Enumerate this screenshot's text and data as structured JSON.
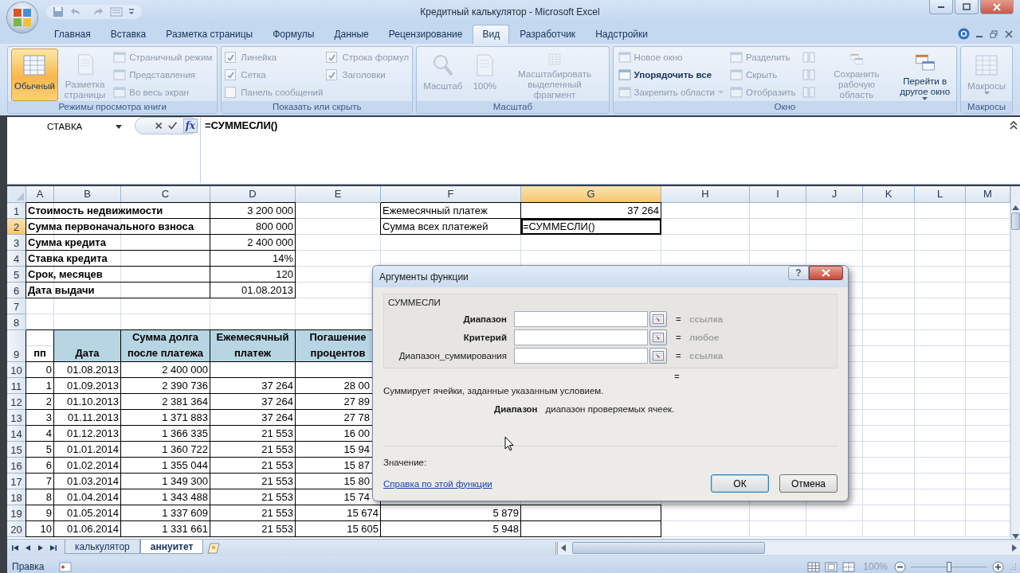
{
  "window": {
    "title": "Кредитный калькулятор - Microsoft Excel"
  },
  "tabs": [
    {
      "label": "Главная",
      "selected": false
    },
    {
      "label": "Вставка",
      "selected": false
    },
    {
      "label": "Разметка страницы",
      "selected": false
    },
    {
      "label": "Формулы",
      "selected": false
    },
    {
      "label": "Данные",
      "selected": false
    },
    {
      "label": "Рецензирование",
      "selected": false
    },
    {
      "label": "Вид",
      "selected": true
    },
    {
      "label": "Разработчик",
      "selected": false
    },
    {
      "label": "Надстройки",
      "selected": false
    }
  ],
  "ribbon": {
    "groups": [
      {
        "label": "Режимы просмотра книги",
        "items": [
          {
            "kind": "large",
            "lines": [
              "Обычный"
            ],
            "selected": true,
            "disabled": false,
            "dropdown": false
          },
          {
            "kind": "large",
            "lines": [
              "Разметка",
              "страницы"
            ],
            "selected": false,
            "disabled": true,
            "dropdown": false
          },
          {
            "kind": "small",
            "lines": [
              "Страничный режим"
            ],
            "disabled": true,
            "dropdown": false
          },
          {
            "kind": "small",
            "lines": [
              "Представления"
            ],
            "disabled": true,
            "dropdown": false
          },
          {
            "kind": "small",
            "lines": [
              "Во весь экран"
            ],
            "disabled": true,
            "dropdown": false
          }
        ]
      },
      {
        "label": "Показать или скрыть",
        "items": [
          {
            "kind": "check",
            "lines": [
              "Линейка"
            ],
            "checked": true,
            "disabled": true
          },
          {
            "kind": "check",
            "lines": [
              "Сетка"
            ],
            "checked": true,
            "disabled": true
          },
          {
            "kind": "check",
            "lines": [
              "Панель сообщений"
            ],
            "checked": false,
            "disabled": true
          },
          {
            "kind": "check",
            "lines": [
              "Строка формул"
            ],
            "checked": true,
            "disabled": true
          },
          {
            "kind": "check",
            "lines": [
              "Заголовки"
            ],
            "checked": true,
            "disabled": true
          }
        ]
      },
      {
        "label": "Масштаб",
        "items": [
          {
            "kind": "large",
            "lines": [
              "Масштаб"
            ],
            "disabled": true,
            "dropdown": false
          },
          {
            "kind": "large",
            "lines": [
              "100%"
            ],
            "disabled": true,
            "dropdown": false
          },
          {
            "kind": "large",
            "lines": [
              "Масштабировать",
              "выделенный фрагмент"
            ],
            "disabled": true,
            "dropdown": false
          }
        ]
      },
      {
        "label": "Окно",
        "items": [
          {
            "kind": "small",
            "lines": [
              "Новое окно"
            ],
            "disabled": true,
            "dropdown": false
          },
          {
            "kind": "small",
            "lines": [
              "Упорядочить все"
            ],
            "disabled": false,
            "dropdown": false
          },
          {
            "kind": "small",
            "lines": [
              "Закрепить области"
            ],
            "disabled": true,
            "dropdown": true
          },
          {
            "kind": "small",
            "lines": [
              "Разделить"
            ],
            "disabled": true,
            "dropdown": false
          },
          {
            "kind": "small",
            "lines": [
              "Скрыть"
            ],
            "disabled": true,
            "dropdown": false
          },
          {
            "kind": "small",
            "lines": [
              "Отобразить"
            ],
            "disabled": true,
            "dropdown": false
          },
          {
            "kind": "icon",
            "disabled": true
          },
          {
            "kind": "icon",
            "disabled": true
          },
          {
            "kind": "icon",
            "disabled": true
          },
          {
            "kind": "large",
            "lines": [
              "Сохранить",
              "рабочую область"
            ],
            "disabled": true,
            "dropdown": false
          },
          {
            "kind": "large",
            "lines": [
              "Перейти в",
              "другое окно"
            ],
            "disabled": false,
            "dropdown": true
          }
        ]
      },
      {
        "label": "Макросы",
        "items": [
          {
            "kind": "large",
            "lines": [
              "Макросы"
            ],
            "disabled": true,
            "dropdown": true
          }
        ]
      }
    ]
  },
  "formula_bar": {
    "name_box": "СТАВКА",
    "function_button": "fx",
    "formula": "=СУММЕСЛИ()"
  },
  "sheet": {
    "columns": [
      {
        "label": "A",
        "selected": false
      },
      {
        "label": "B",
        "selected": false
      },
      {
        "label": "C",
        "selected": false
      },
      {
        "label": "D",
        "selected": false
      },
      {
        "label": "E",
        "selected": false
      },
      {
        "label": "F",
        "selected": false
      },
      {
        "label": "G",
        "selected": true
      },
      {
        "label": "H",
        "selected": false
      },
      {
        "label": "I",
        "selected": false
      },
      {
        "label": "J",
        "selected": false
      },
      {
        "label": "K",
        "selected": false
      },
      {
        "label": "L",
        "selected": false
      },
      {
        "label": "M",
        "selected": false
      }
    ],
    "rows": [
      {
        "number": "1",
        "selected": false,
        "kind": "param",
        "cells": [
          "Стоимость недвижимости",
          "3 200 000",
          null,
          "Ежемесячный платеж",
          "37 264"
        ]
      },
      {
        "number": "2",
        "selected": true,
        "kind": "param",
        "cells": [
          "Сумма первоначального взноса",
          "800 000",
          null,
          "Сумма всех платежей",
          "=СУММЕСЛИ()"
        ]
      },
      {
        "number": "3",
        "selected": false,
        "kind": "param",
        "cells": [
          "Сумма кредита",
          "2 400 000"
        ]
      },
      {
        "number": "4",
        "selected": false,
        "kind": "param",
        "cells": [
          "Ставка кредита",
          "14%"
        ]
      },
      {
        "number": "5",
        "selected": false,
        "kind": "param",
        "cells": [
          "Срок, месяцев",
          "120"
        ]
      },
      {
        "number": "6",
        "selected": false,
        "kind": "param",
        "cells": [
          "Дата выдачи",
          "01.08.2013"
        ]
      },
      {
        "number": "7",
        "selected": false,
        "kind": "blank"
      },
      {
        "number": "8",
        "selected": false,
        "kind": "blank"
      },
      {
        "number": "9",
        "selected": false,
        "kind": "header",
        "cells": [
          "пп",
          "Дата",
          "Сумма долга после платежа",
          "Ежемесячный платеж",
          "Погашение процентов"
        ]
      },
      {
        "number": "10",
        "selected": false,
        "kind": "data",
        "cells": [
          "0",
          "01.08.2013",
          "2 400 000"
        ]
      },
      {
        "number": "11",
        "selected": false,
        "kind": "data",
        "cells": [
          "1",
          "01.09.2013",
          "2 390 736",
          "37 264",
          {
            "text": "28 00",
            "cut": true
          }
        ]
      },
      {
        "number": "12",
        "selected": false,
        "kind": "data",
        "cells": [
          "2",
          "01.10.2013",
          "2 381 364",
          "37 264",
          {
            "text": "27 89",
            "cut": true
          }
        ]
      },
      {
        "number": "13",
        "selected": false,
        "kind": "data",
        "cells": [
          "3",
          "01.11.2013",
          "1 371 883",
          "37 264",
          {
            "text": "27 78",
            "cut": true
          }
        ]
      },
      {
        "number": "14",
        "selected": false,
        "kind": "data",
        "cells": [
          "4",
          "01.12.2013",
          "1 366 335",
          "21 553",
          {
            "text": "16 00",
            "cut": true
          }
        ]
      },
      {
        "number": "15",
        "selected": false,
        "kind": "data",
        "cells": [
          "5",
          "01.01.2014",
          "1 360 722",
          "21 553",
          {
            "text": "15 94",
            "cut": true
          }
        ]
      },
      {
        "number": "16",
        "selected": false,
        "kind": "data",
        "cells": [
          "6",
          "01.02.2014",
          "1 355 044",
          "21 553",
          {
            "text": "15 87",
            "cut": true
          }
        ]
      },
      {
        "number": "17",
        "selected": false,
        "kind": "data",
        "cells": [
          "7",
          "01.03.2014",
          "1 349 300",
          "21 553",
          {
            "text": "15 80",
            "cut": true
          }
        ]
      },
      {
        "number": "18",
        "selected": false,
        "kind": "data",
        "cells": [
          "8",
          "01.04.2014",
          "1 343 488",
          "21 553",
          {
            "text": "15 74",
            "cut": true
          }
        ]
      },
      {
        "number": "19",
        "selected": false,
        "kind": "data",
        "cells": [
          "9",
          "01.05.2014",
          "1 337 609",
          "21 553",
          "15 674",
          "5 879"
        ]
      },
      {
        "number": "20",
        "selected": false,
        "kind": "data",
        "cells": [
          "10",
          "01.06.2014",
          "1 331 661",
          "21 553",
          "15 605",
          "5 948"
        ]
      }
    ]
  },
  "sheet_tabs": [
    {
      "label": "калькулятор",
      "selected": false
    },
    {
      "label": "аннуитет",
      "selected": true
    }
  ],
  "status_bar": {
    "mode": "Правка",
    "zoom": "100%",
    "zoom_slider": {
      "level": 0.5
    }
  },
  "dialog": {
    "title": "Аргументы функции",
    "help": "?",
    "function": "СУММЕСЛИ",
    "arguments": [
      {
        "name": "Диапазон",
        "required": true,
        "sign": "=",
        "hint": "ссылка"
      },
      {
        "name": "Критерий",
        "required": true,
        "sign": "=",
        "hint": "любое"
      },
      {
        "name": "Диапазон_суммирования",
        "required": false,
        "sign": "=",
        "hint": "ссылка"
      }
    ],
    "result_sign": "=",
    "description": "Суммирует ячейки, заданные указанным условием.",
    "argument_help": {
      "name": "Диапазон",
      "text": "диапазон проверяемых ячеек."
    },
    "value_label": "Значение:",
    "help_link": "Справка по этой функции",
    "buttons": [
      {
        "label": "ОК",
        "default": true
      },
      {
        "label": "Отмена",
        "default": false
      }
    ]
  }
}
